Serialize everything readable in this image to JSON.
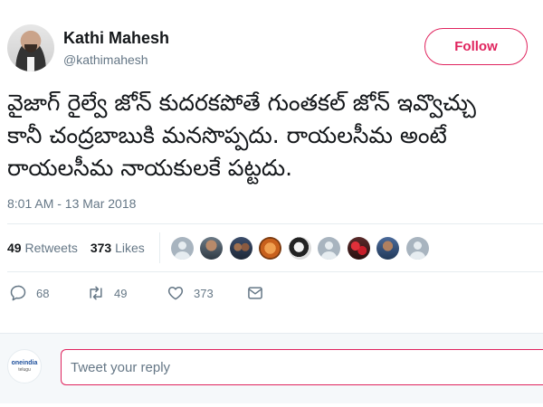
{
  "author": {
    "name": "Kathi Mahesh",
    "handle": "@kathimahesh"
  },
  "follow_label": "Follow",
  "tweet": {
    "lines": [
      "వైజాగ్ రైల్వే జోన్ కుదరకపోతే గుంతకల్ జోన్ ఇవ్వొచ్చు",
      "కానీ చంద్రబాబుకి మనసొప్పదు. రాయలసీమ అంటే",
      "రాయలసీమ నాయకులకే పట్టదు."
    ],
    "timestamp": "8:01 AM - 13 Mar 2018"
  },
  "stats": {
    "retweets_count": "49",
    "retweets_label": "Retweets",
    "likes_count": "373",
    "likes_label": "Likes"
  },
  "liker_avatars": [
    "default",
    "man-dark",
    "man-group",
    "orange",
    "bw-woman",
    "default",
    "red-flowers",
    "man-blue",
    "default"
  ],
  "actions": {
    "replies": "68",
    "retweets": "49",
    "likes": "373"
  },
  "reply": {
    "avatar_text": "oneindia",
    "avatar_subtext": "telugu",
    "placeholder": "Tweet your reply"
  },
  "colors": {
    "accent": "#e0245e",
    "secondary_text": "#657786",
    "divider": "#e6ecf0"
  }
}
